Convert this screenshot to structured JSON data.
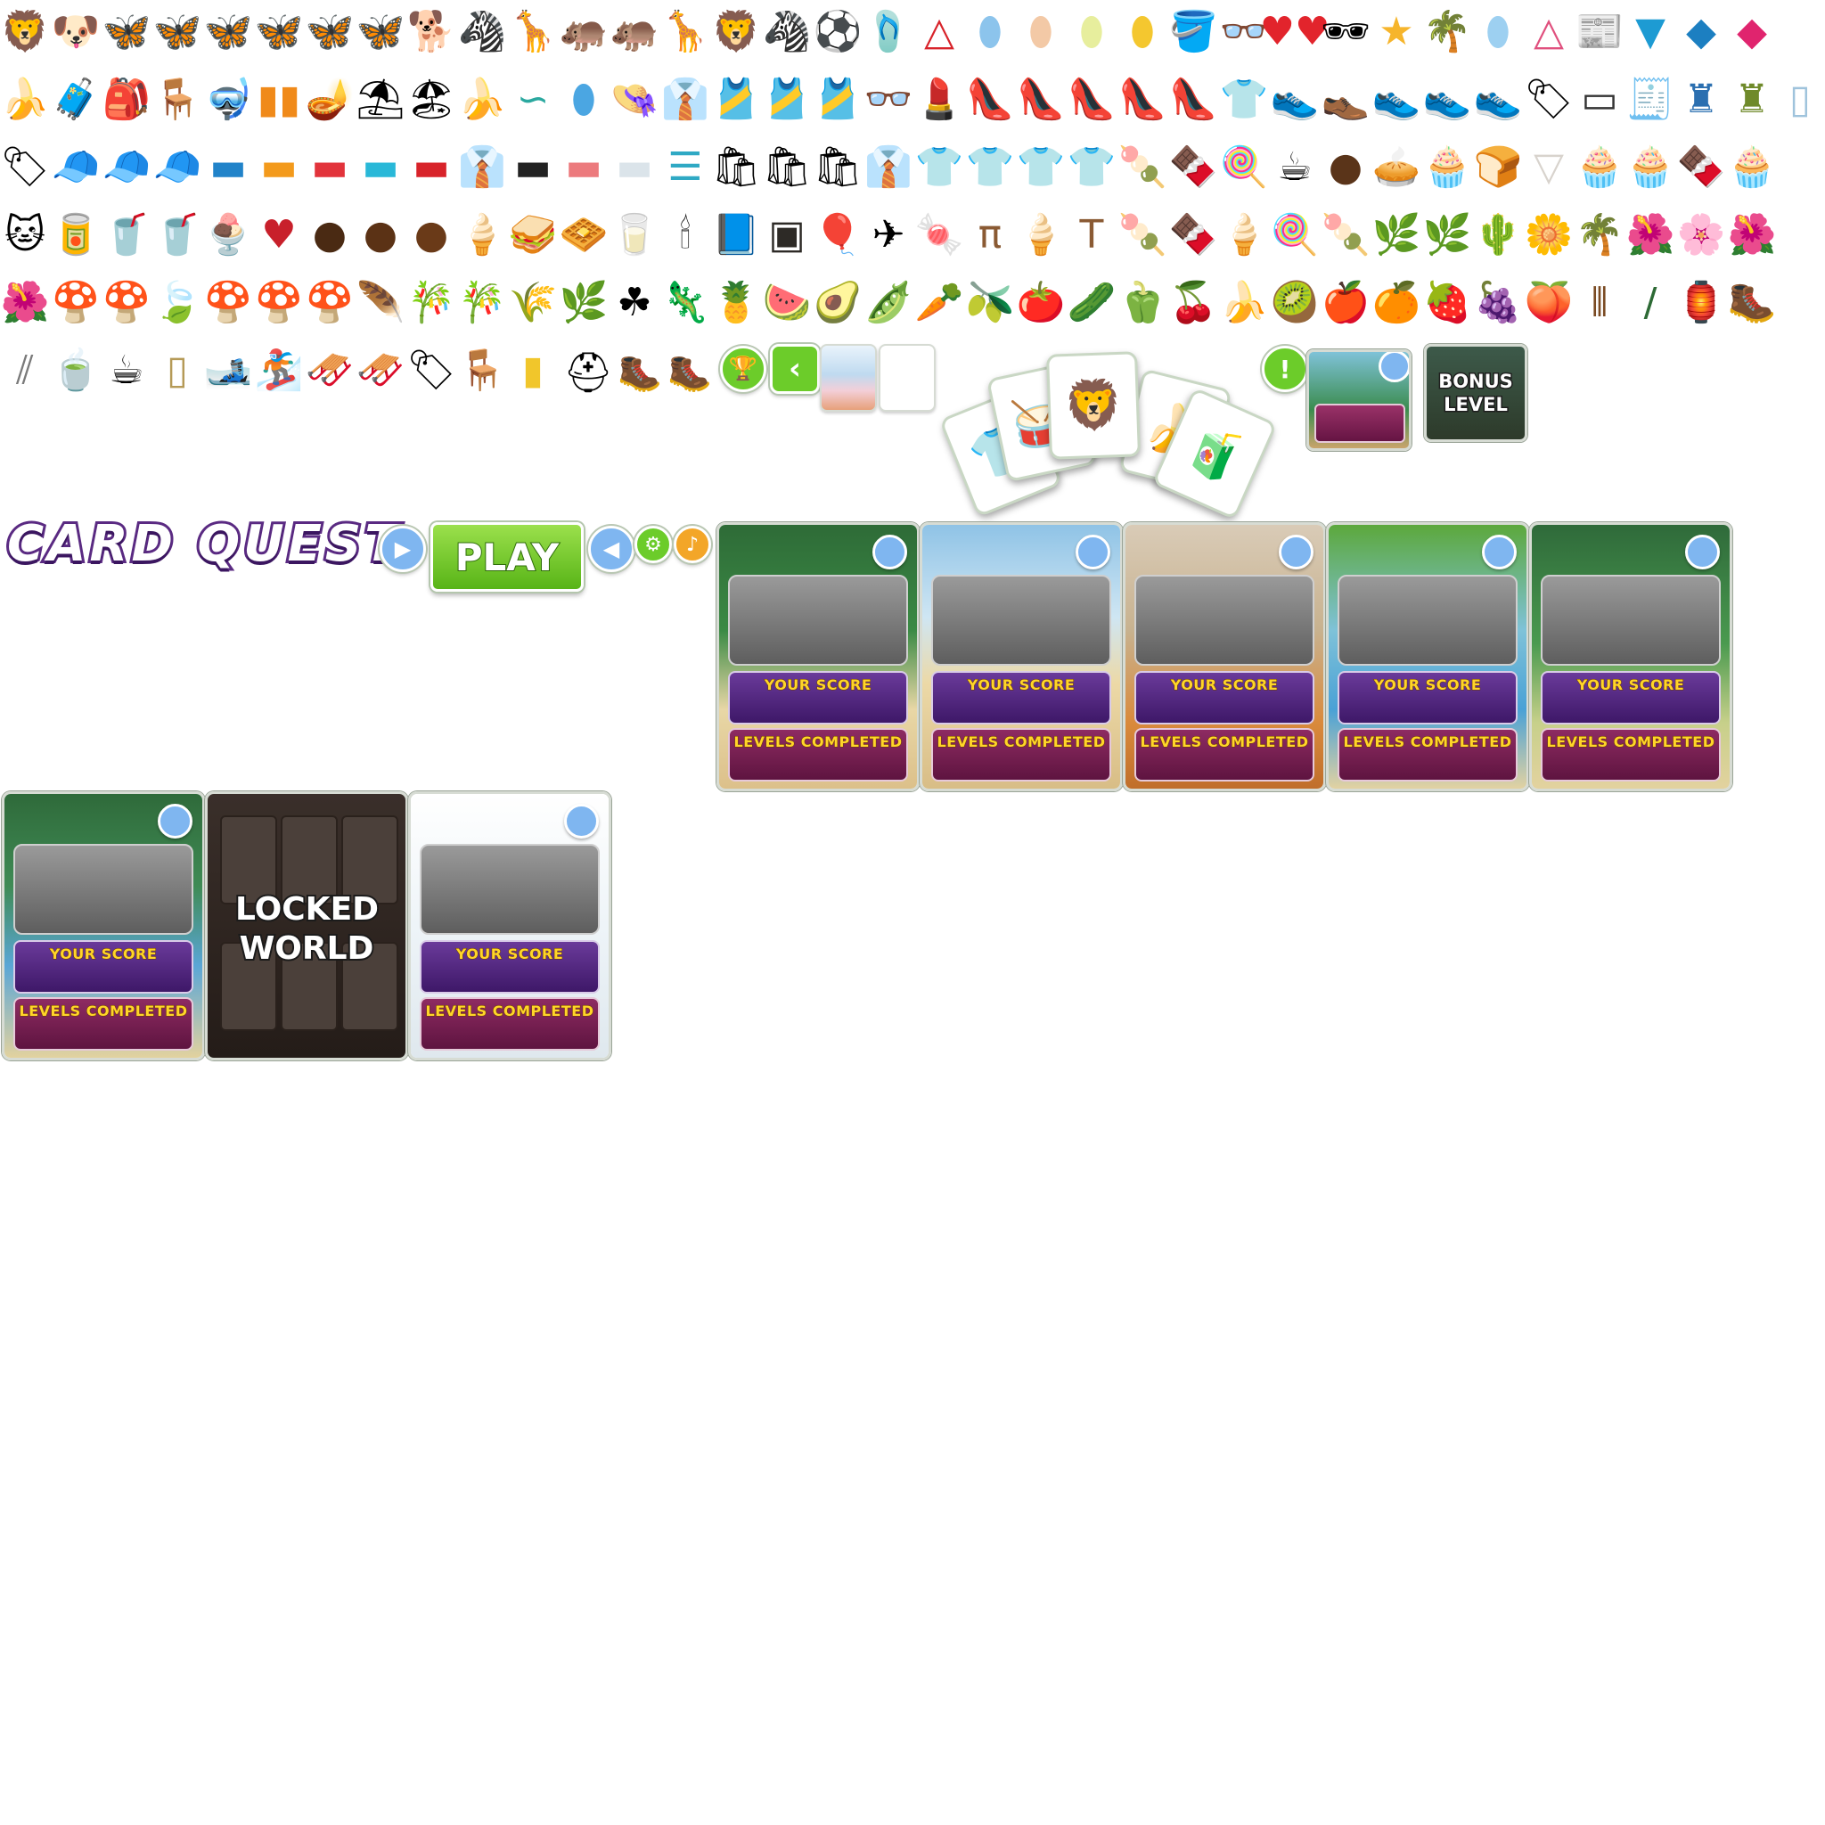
{
  "title": "CARD QUEST",
  "play_label": "PLAY",
  "your_score_label": "YOUR SCORE",
  "levels_completed_label": "LEVELS COMPLETED",
  "locked_world_label": "LOCKED WORLD",
  "bonus_level_label": "BONUS LEVEL",
  "colors": {
    "purple_title": "#5a2a82",
    "green_button": "#58b417",
    "score_panel": "#4f2380",
    "levels_panel": "#7a1e52",
    "label_yellow": "#ffd529",
    "bubble_blue": "#7fb6f0"
  },
  "sprite_rows": [
    {
      "icons": [
        "lion-icon",
        "puppy-icon",
        "butterfly-red-icon",
        "butterfly-blue-icon",
        "butterfly-pink-icon",
        "butterfly-yellow-icon",
        "butterfly-striped-icon",
        "butterfly-purple-icon",
        "dog-toy-icon",
        "zebra-icon",
        "giraffe-icon",
        "hippo-icon",
        "hippo-pink-icon",
        "giraffe-small-icon",
        "lion-mane-icon",
        "zebra-small-icon",
        "beach-ball-icon",
        "flip-flops-icon",
        "hanger-icon",
        "surfboard-blue-icon",
        "surfboard-peach-icon",
        "surfboard-yellow-icon",
        "surfboard-red-icon",
        "sand-bucket-icon",
        "glasses-icon",
        "heart-glasses-icon",
        "sunglasses-icon",
        "starfish-icon",
        "palm-island-icon",
        "surfboard-light-icon",
        "hangers-icon",
        "magazines-icon",
        "funnel-icon",
        "fin-blue-icon",
        "fin-pink-icon"
      ]
    },
    {
      "icons": [
        "banana-icon",
        "suitcase-icon",
        "backpack-icon",
        "beach-chair-icon",
        "diving-mask-icon",
        "scuba-tanks-icon",
        "fan-lamp-icon",
        "umbrella-icon",
        "sand-toys-icon",
        "banana-peel-icon",
        "snorkel-icon",
        "surfboard-long-icon",
        "sun-hat-icon",
        "shirt-folded-icon",
        "tank-top-red-icon",
        "tank-top-cyan-icon",
        "tank-top-pink-icon",
        "eyeglasses-icon",
        "lipstick-icon",
        "heel-red-icon",
        "heel-green-icon",
        "heel-yellow-icon",
        "heel-black-icon",
        "heel-pink-icon",
        "shirt-yellow-icon",
        "sneaker-blue-icon",
        "sneaker-beige-icon",
        "sneaker-pink-icon",
        "sneaker-lime-icon",
        "sneaker-white-icon",
        "price-tags-icon",
        "belt-icon",
        "receipt-icon",
        "mannequin-blue-icon",
        "mannequin-green-icon",
        "shirt-pink-icon",
        "mirror-icon"
      ]
    },
    {
      "icons": [
        "sale-tag-icon",
        "cap-blue-icon",
        "cap-orange-icon",
        "cap-a-icon",
        "shoebox-blue-icon",
        "shoebox-orange-icon",
        "shoebox-red-icon",
        "shirt-stack-cyan-icon",
        "shirt-stack-red-icon",
        "shirt-green-icon",
        "shirt-black-icon",
        "shirt-salmon-icon",
        "shirt-white-icon",
        "shirt-pile-icon",
        "shopping-bag-red-icon",
        "shopping-bag-yellow-icon",
        "shopping-bag-blue-icon",
        "shirt-hanger-white-icon",
        "tshirt-gray-icon",
        "tshirt-green-icon",
        "tshirt-orange-icon",
        "tshirt-purple-icon",
        "popsicle-green-icon",
        "popsicle-choco-icon",
        "lollipop-icon",
        "coffee-cup-icon",
        "chocolate-ball-icon",
        "tart-icon",
        "cupcake-icon",
        "bread-icon",
        "cupcake-liner-icon",
        "muffin-icon",
        "cupcake-blue-icon",
        "ice-pop-icon",
        "cupcake-green-icon"
      ]
    },
    {
      "icons": [
        "lucky-cat-icon",
        "soda-cans-icon",
        "drinks-icon",
        "soda-cup-icon",
        "sundae-icon",
        "heart-chocolate-icon",
        "chocolate-truffle-icon",
        "chocolate-swirl-icon",
        "chocolate-bonbon-icon",
        "ice-cream-green-icon",
        "sandwich-icon",
        "waffle-icon",
        "milk-carton-icon",
        "candle-icon",
        "book-icon",
        "chalkboard-icon",
        "balloons-icon",
        "toy-plane-icon",
        "gumball-icon",
        "stool-icon",
        "ice-cream-orange-icon",
        "table-icon",
        "popsicle-rainbow-icon",
        "popsicle-brown-icon",
        "cone-icon",
        "popsicle-pink-icon",
        "popsicle-lime-icon",
        "palm-plant-icon",
        "fern-icon",
        "cactus-icon",
        "daisy-icon",
        "palm-small-icon",
        "hibiscus-red-icon",
        "hibiscus-purple-icon",
        "hibiscus-pink-icon"
      ]
    },
    {
      "icons": [
        "red-flower-icon",
        "mushroom-white-icon",
        "mushroom-red-icon",
        "leaf-icon",
        "mushroom-orange-icon",
        "mushroom-brown-icon",
        "mushroom-pale-icon",
        "feather-icon",
        "bamboo-icon",
        "bamboo-tall-icon",
        "grass-icon",
        "leaves-icon",
        "leaves-dark-icon",
        "lizard-icon",
        "pineapple-icon",
        "watermelon-icon",
        "avocado-icon",
        "peas-icon",
        "carrot-icon",
        "radish-icon",
        "tomatoes-icon",
        "cucumber-icon",
        "peppers-icon",
        "cherries-icon",
        "bananas-icon",
        "kiwi-icon",
        "apple-icon",
        "oranges-icon",
        "strawberries-icon",
        "grapes-icon",
        "peach-icon",
        "sled-icon",
        "ski-pole-icon",
        "lantern-icon",
        "boot-icon"
      ]
    },
    {
      "icons": [
        "ski-poles-icon",
        "teacup-icon",
        "coffee-machine-icon",
        "cabinet-icon",
        "ski-icon",
        "snowboard-icon",
        "sleigh-icon",
        "toboggan-icon",
        "ski-tags-icon",
        "dining-set-icon",
        "ski-yellow-icon"
      ]
    }
  ],
  "world_cards": [
    {
      "scene": "jungle",
      "label_score": "YOUR SCORE",
      "label_levels": "LEVELS COMPLETED"
    },
    {
      "scene": "beach",
      "label_score": "YOUR SCORE",
      "label_levels": "LEVELS COMPLETED"
    },
    {
      "scene": "shop",
      "label_score": "YOUR SCORE",
      "label_levels": "LEVELS COMPLETED"
    },
    {
      "scene": "tropical",
      "label_score": "YOUR SCORE",
      "label_levels": "LEVELS COMPLETED"
    },
    {
      "scene": "forest",
      "label_score": "YOUR SCORE",
      "label_levels": "LEVELS COMPLETED"
    },
    {
      "scene": "river",
      "label_score": "YOUR SCORE",
      "label_levels": "LEVELS COMPLETED"
    },
    {
      "scene": "snow",
      "label_score": "YOUR SCORE",
      "label_levels": "LEVELS COMPLETED"
    }
  ]
}
